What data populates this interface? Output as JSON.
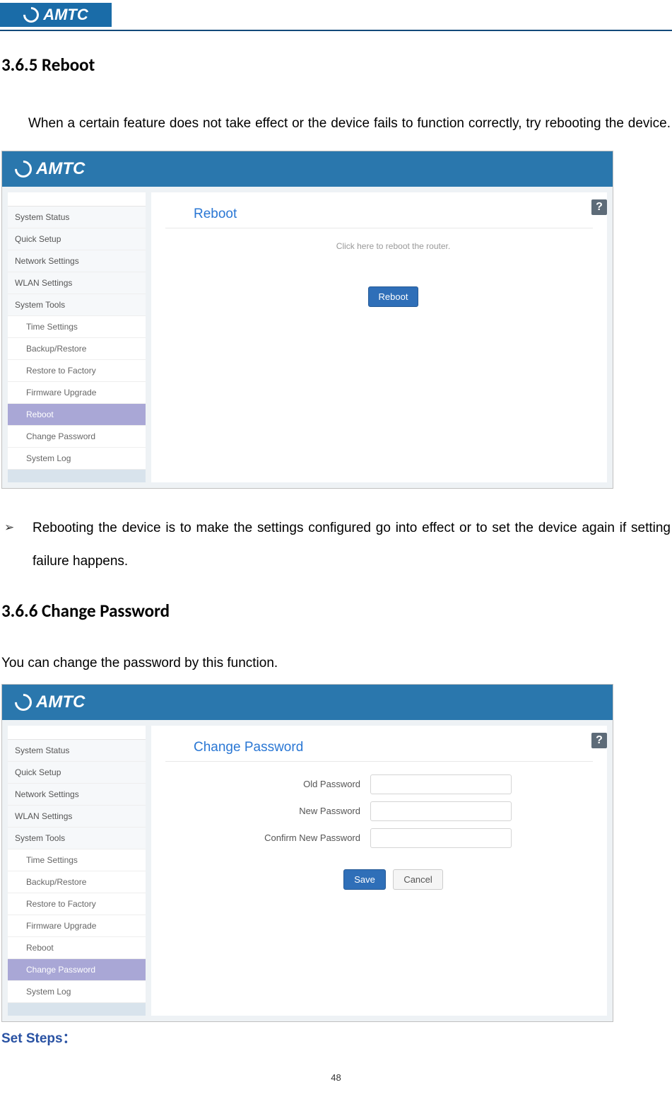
{
  "doc": {
    "logo_text": "AMTC",
    "section_reboot_title": "3.6.5 Reboot",
    "reboot_intro": "When a certain feature does not take effect or the device fails to function correctly, try rebooting the device.",
    "bullet_text": "Rebooting the device is to make the settings configured go into effect or to set the device again if setting failure happens.",
    "section_changepw_title": "3.6.6 Change Password",
    "changepw_intro": "You can change the password by this function.",
    "set_steps_label": "Set Steps：",
    "page_number": "48"
  },
  "screenshot_common": {
    "logo": "AMTC",
    "help_icon": "?",
    "sidebar": {
      "items": [
        {
          "label": "System Status",
          "type": "main"
        },
        {
          "label": "Quick Setup",
          "type": "main"
        },
        {
          "label": "Network Settings",
          "type": "main"
        },
        {
          "label": "WLAN Settings",
          "type": "main"
        },
        {
          "label": "System Tools",
          "type": "main"
        },
        {
          "label": "Time Settings",
          "type": "sub"
        },
        {
          "label": "Backup/Restore",
          "type": "sub"
        },
        {
          "label": "Restore to Factory",
          "type": "sub"
        },
        {
          "label": "Firmware Upgrade",
          "type": "sub"
        },
        {
          "label": "Reboot",
          "type": "sub"
        },
        {
          "label": "Change Password",
          "type": "sub"
        },
        {
          "label": "System Log",
          "type": "sub"
        }
      ]
    }
  },
  "reboot_panel": {
    "title": "Reboot",
    "hint": "Click here to reboot the router.",
    "button": "Reboot",
    "active_index": 9
  },
  "changepw_panel": {
    "title": "Change Password",
    "fields": {
      "old": "Old Password",
      "new": "New Password",
      "confirm": "Confirm New Password"
    },
    "save": "Save",
    "cancel": "Cancel",
    "active_index": 10
  }
}
